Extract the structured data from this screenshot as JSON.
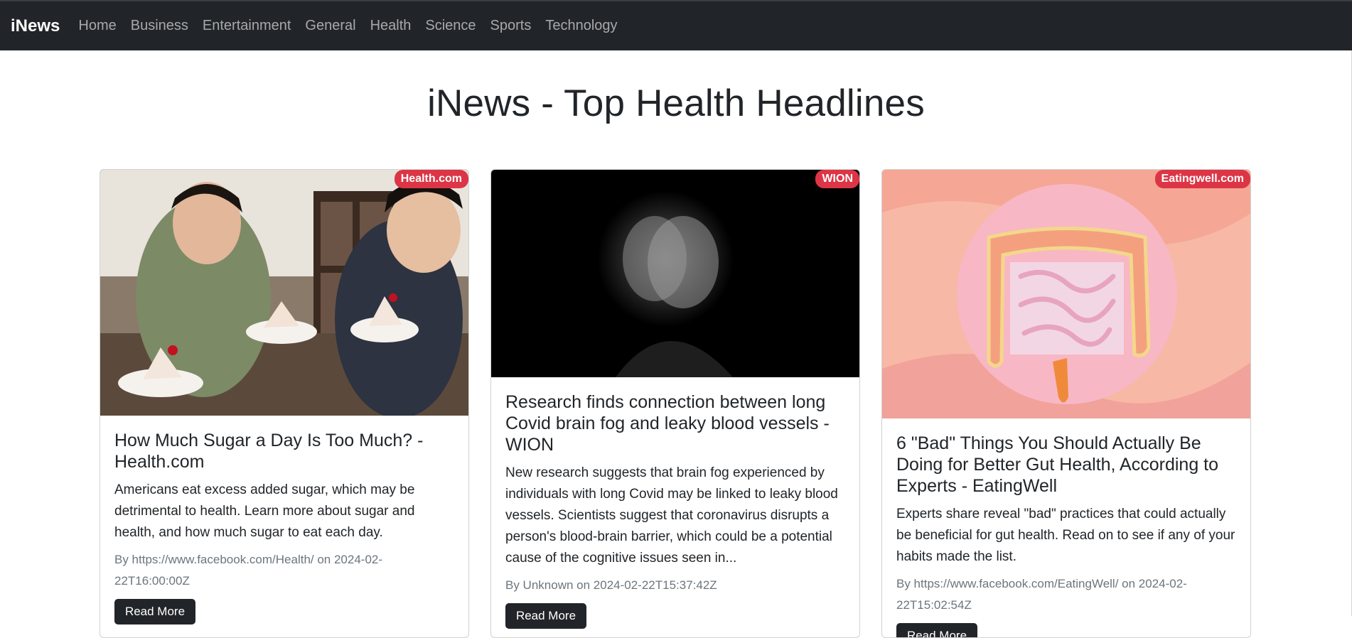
{
  "nav": {
    "brand": "iNews",
    "links": [
      "Home",
      "Business",
      "Entertainment",
      "General",
      "Health",
      "Science",
      "Sports",
      "Technology"
    ]
  },
  "page": {
    "title": "iNews - Top Health Headlines"
  },
  "articles": [
    {
      "source": "Health.com",
      "title": "How Much Sugar a Day Is Too Much? - Health.com",
      "description": "Americans eat excess added sugar, which may be detrimental to health. Learn more about sugar and health, and how much sugar to eat each day.",
      "author": "https://www.facebook.com/Health/",
      "date": "2024-02-22T16:00:00Z",
      "byline": "By https://www.facebook.com/Health/ on 2024-02-22T16:00:00Z",
      "button": "Read More"
    },
    {
      "source": "WION",
      "title": "Research finds connection between long Covid brain fog and leaky blood vessels - WION",
      "description": "New research suggests that brain fog experienced by individuals with long Covid may be linked to leaky blood vessels. Scientists suggest that coronavirus disrupts a person's blood-brain barrier, which could be a potential cause of the cognitive issues seen in...",
      "author": "Unknown",
      "date": "2024-02-22T15:37:42Z",
      "byline": "By Unknown on 2024-02-22T15:37:42Z",
      "button": "Read More"
    },
    {
      "source": "Eatingwell.com",
      "title": "6 \"Bad\" Things You Should Actually Be Doing for Better Gut Health, According to Experts - EatingWell",
      "description": "Experts share reveal \"bad\" practices that could actually be beneficial for gut health. Read on to see if any of your habits made the list.",
      "author": "https://www.facebook.com/EatingWell/",
      "date": "2024-02-22T15:02:54Z",
      "byline": "By https://www.facebook.com/EatingWell/ on 2024-02-22T15:02:54Z",
      "button": "Read More"
    }
  ],
  "colors": {
    "navbar_bg": "#212529",
    "badge_bg": "#dc3545",
    "muted_text": "#6c757d"
  }
}
